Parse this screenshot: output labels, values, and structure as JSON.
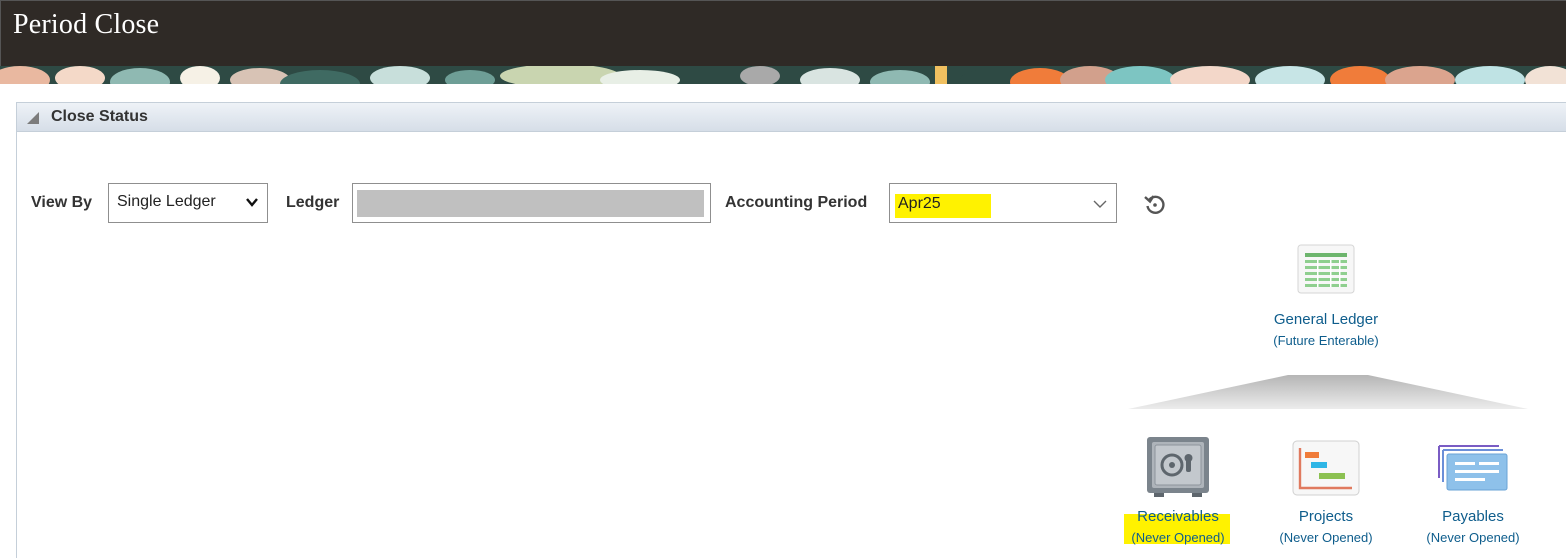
{
  "header": {
    "title": "Period Close"
  },
  "panel": {
    "title": "Close Status"
  },
  "filters": {
    "view_by_label": "View By",
    "view_by_value": "Single Ledger",
    "ledger_label": "Ledger",
    "ledger_value": "",
    "period_label": "Accounting Period",
    "period_value": "Apr25"
  },
  "hierarchy": {
    "root": {
      "name": "General Ledger",
      "status": "(Future Enterable)",
      "icon": "ledger-grid-icon"
    },
    "children": [
      {
        "name": "Receivables",
        "status": "(Never Opened)",
        "icon": "safe-icon"
      },
      {
        "name": "Projects",
        "status": "(Never Opened)",
        "icon": "gantt-chart-icon"
      },
      {
        "name": "Payables",
        "status": "(Never Opened)",
        "icon": "payables-cards-icon"
      }
    ]
  },
  "colors": {
    "header_bg": "#2f2a26",
    "link": "#0e5d8c",
    "highlight": "#fff200"
  }
}
